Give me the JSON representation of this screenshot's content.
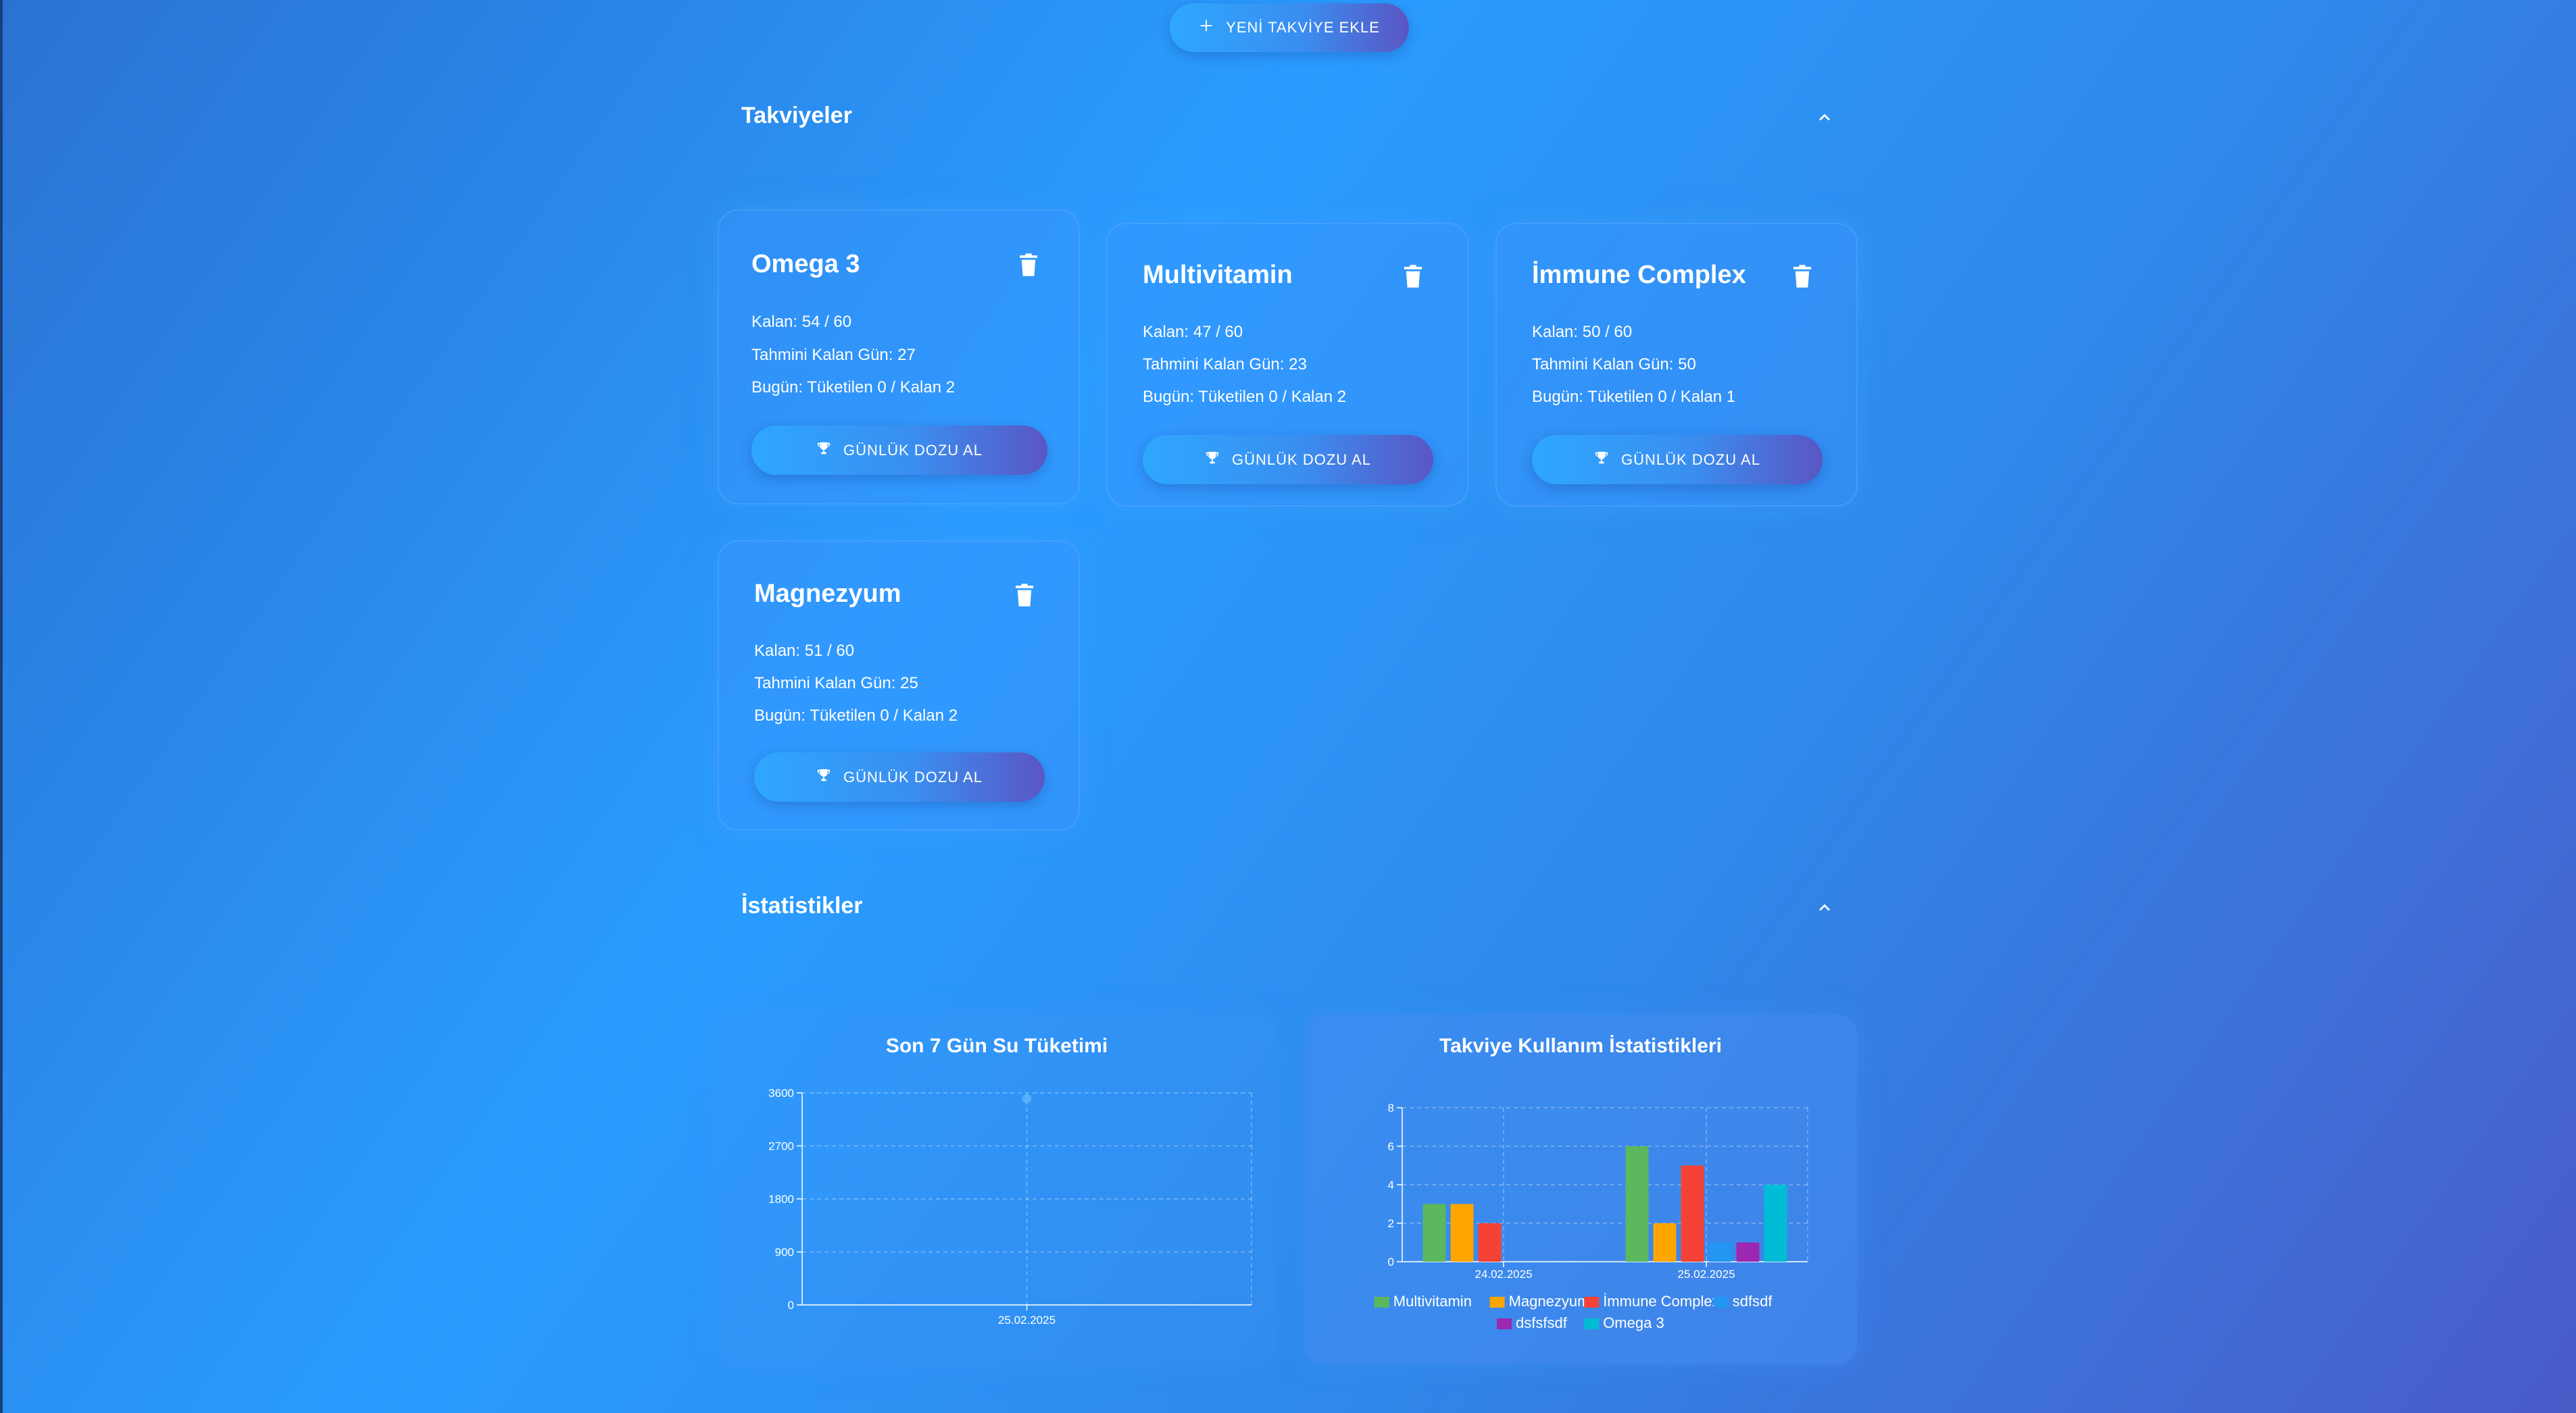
{
  "header": {
    "add_button_label": "YENİ TAKVİYE EKLE"
  },
  "supplements_section": {
    "title": "Takviyeler"
  },
  "supplements": [
    {
      "name": "Omega 3",
      "remaining": "Kalan: 54 / 60",
      "days_left": "Tahmini Kalan Gün: 27",
      "today": "Bugün: Tüketilen 0 / Kalan 2",
      "button": "GÜNLÜK DOZU AL"
    },
    {
      "name": "Multivitamin",
      "remaining": "Kalan: 47 / 60",
      "days_left": "Tahmini Kalan Gün: 23",
      "today": "Bugün: Tüketilen 0 / Kalan 2",
      "button": "GÜNLÜK DOZU AL"
    },
    {
      "name": "İmmune Complex",
      "remaining": "Kalan: 50 / 60",
      "days_left": "Tahmini Kalan Gün: 50",
      "today": "Bugün: Tüketilen 0 / Kalan 1",
      "button": "GÜNLÜK DOZU AL"
    },
    {
      "name": "Magnezyum",
      "remaining": "Kalan: 51 / 60",
      "days_left": "Tahmini Kalan Gün: 25",
      "today": "Bugün: Tüketilen 0 / Kalan 2",
      "button": "GÜNLÜK DOZU AL"
    }
  ],
  "stats_section": {
    "title": "İstatistikler"
  },
  "chart_data": [
    {
      "type": "line",
      "title": "Son 7 Gün Su Tüketimi",
      "x": [
        "25.02.2025"
      ],
      "series": [
        {
          "values": [
            3500
          ]
        }
      ],
      "ylim": [
        0,
        3600
      ],
      "yticks": [
        "3600",
        "2700",
        "1800",
        "900",
        "0"
      ],
      "grid": true,
      "color": "#4fb0ff"
    },
    {
      "type": "bar",
      "title": "Takviye Kullanım İstatistikleri",
      "categories": [
        "24.02.2025",
        "25.02.2025"
      ],
      "series": [
        {
          "name": "Multivitamin",
          "values": [
            3,
            6
          ],
          "color": "#5cb85c"
        },
        {
          "name": "Magnezyum",
          "values": [
            3,
            2
          ],
          "color": "#ffa500"
        },
        {
          "name": "İmmune Complex",
          "values": [
            2,
            5
          ],
          "color": "#f44336"
        },
        {
          "name": "sdfsdf",
          "values": [
            0,
            1
          ],
          "color": "#2196f3"
        },
        {
          "name": "dsfsfsdf",
          "values": [
            0,
            1
          ],
          "color": "#9c27b0"
        },
        {
          "name": "Omega 3",
          "values": [
            0,
            4
          ],
          "color": "#00bcd4"
        }
      ],
      "ylim": [
        0,
        8
      ],
      "yticks": [
        "8",
        "6",
        "4",
        "2",
        "0"
      ],
      "grid": true,
      "legend": "bottom"
    }
  ]
}
